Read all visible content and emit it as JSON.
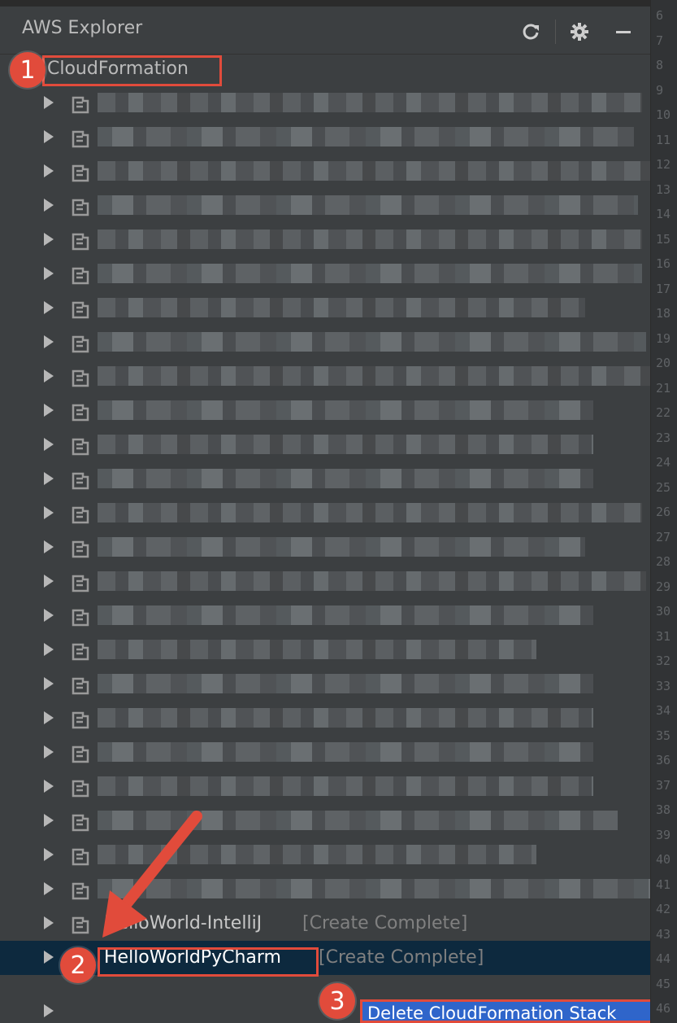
{
  "panel": {
    "title": "AWS Explorer",
    "icons": [
      "refresh-icon",
      "gear-icon",
      "minimize-icon"
    ]
  },
  "tree": {
    "root_label": "CloudFormation",
    "redacted_stack_count": 24,
    "visible_stacks": [
      {
        "name": "HelloWorld-IntelliJ",
        "status": "[Create Complete]"
      },
      {
        "name": "HelloWorldPyCharm",
        "status": "[Create Complete]",
        "selected": true
      }
    ]
  },
  "context_menu": {
    "item": "Delete CloudFormation Stack"
  },
  "callouts": [
    "1",
    "2",
    "3"
  ],
  "gutter": {
    "line_numbers": [
      "6",
      "7",
      "8",
      "9",
      "10",
      "11",
      "12",
      "13",
      "14",
      "15",
      "16",
      "17",
      "18",
      "19",
      "20",
      "21",
      "22",
      "23",
      "24",
      "25",
      "26",
      "27",
      "28",
      "29",
      "30",
      "31",
      "32",
      "33",
      "34",
      "35",
      "36",
      "37",
      "38",
      "39",
      "40",
      "41",
      "42",
      "43",
      "44",
      "45",
      "46"
    ]
  },
  "colors": {
    "accent_red": "#e14b3b",
    "selection": "#0d293e",
    "menu_highlight": "#2f65ca"
  }
}
